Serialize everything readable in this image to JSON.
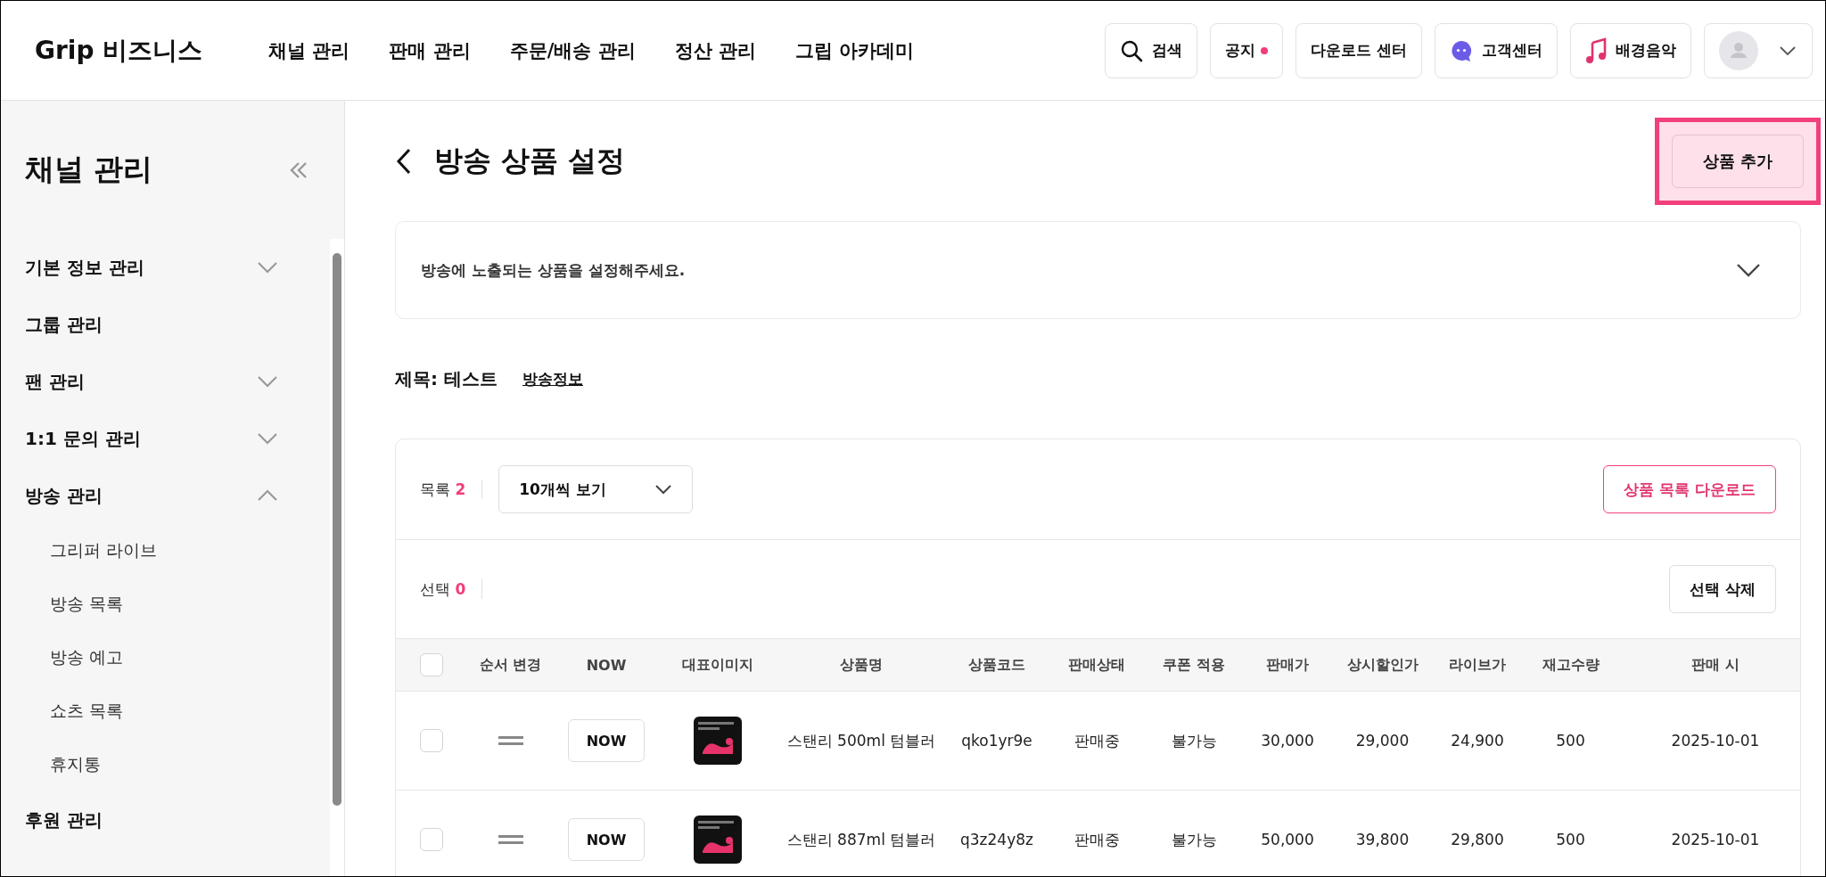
{
  "header": {
    "logo": "Grip",
    "logo_suffix": "비즈니스",
    "nav": [
      "채널 관리",
      "판매 관리",
      "주문/배송 관리",
      "정산 관리",
      "그립 아카데미"
    ],
    "actions": [
      {
        "kind": "search",
        "label": "검색"
      },
      {
        "kind": "notice",
        "label": "공지",
        "unread": true
      },
      {
        "kind": "plain",
        "label": "다운로드 센터"
      },
      {
        "kind": "chat",
        "label": "고객센터"
      },
      {
        "kind": "music",
        "label": "배경음악"
      },
      {
        "kind": "profile"
      }
    ]
  },
  "sidebar": {
    "title": "채널 관리",
    "items": [
      {
        "kind": "group",
        "label": "기본 정보 관리",
        "expanded": false
      },
      {
        "kind": "link",
        "label": "그룹 관리"
      },
      {
        "kind": "group",
        "label": "팬 관리",
        "expanded": false
      },
      {
        "kind": "group",
        "label": "1:1 문의 관리",
        "expanded": false
      },
      {
        "kind": "group",
        "label": "방송 관리",
        "expanded": true,
        "children": [
          "그리퍼 라이브",
          "방송 목록",
          "방송 예고",
          "쇼츠 목록",
          "휴지통"
        ]
      },
      {
        "kind": "link",
        "label": "후원 관리"
      }
    ]
  },
  "page": {
    "title": "방송 상품 설정",
    "add_button": {
      "label": "상품 추가",
      "highlighted": true
    },
    "notice": {
      "text": "방송에 노출되는 상품을 설정해주세요.",
      "expanded": false
    },
    "broadcast": {
      "title": "제목: 테스트",
      "info_link": "방송정보"
    },
    "list": {
      "count_label": "목록",
      "count": "2",
      "page_size": "10개씩 보기",
      "download": "상품 목록 다운로드",
      "selected_label": "선택",
      "selected_count": "0",
      "delete": "선택 삭제"
    },
    "table": {
      "select_all": {
        "checked": false
      },
      "columns": [
        "순서 변경",
        "NOW",
        "대표이미지",
        "상품명",
        "상품코드",
        "판매상태",
        "쿠폰 적용",
        "판매가",
        "상시할인가",
        "라이브가",
        "재고수량",
        "판매 시"
      ],
      "rows": [
        {
          "checked": false,
          "cells": [
            {
              "kind": "handle"
            },
            {
              "kind": "button",
              "text": "NOW"
            },
            {
              "kind": "picture"
            },
            {
              "kind": "text",
              "text": "스탠리 500ml 텀블러"
            },
            {
              "kind": "text",
              "text": "qko1yr9e"
            },
            {
              "kind": "text",
              "text": "판매중"
            },
            {
              "kind": "text",
              "text": "불가능"
            },
            {
              "kind": "text",
              "text": "30,000"
            },
            {
              "kind": "text",
              "text": "29,000"
            },
            {
              "kind": "text",
              "text": "24,900"
            },
            {
              "kind": "text",
              "text": "500"
            },
            {
              "kind": "text",
              "text": "2025-10-01"
            }
          ]
        },
        {
          "checked": false,
          "cells": [
            {
              "kind": "handle"
            },
            {
              "kind": "button",
              "text": "NOW"
            },
            {
              "kind": "picture"
            },
            {
              "kind": "text",
              "text": "스탠리 887ml 텀블러"
            },
            {
              "kind": "text",
              "text": "q3z24y8z"
            },
            {
              "kind": "text",
              "text": "판매중"
            },
            {
              "kind": "text",
              "text": "불가능"
            },
            {
              "kind": "text",
              "text": "50,000"
            },
            {
              "kind": "text",
              "text": "39,800"
            },
            {
              "kind": "text",
              "text": "29,800"
            },
            {
              "kind": "text",
              "text": "500"
            },
            {
              "kind": "text",
              "text": "2025-10-01"
            }
          ]
        }
      ]
    }
  }
}
